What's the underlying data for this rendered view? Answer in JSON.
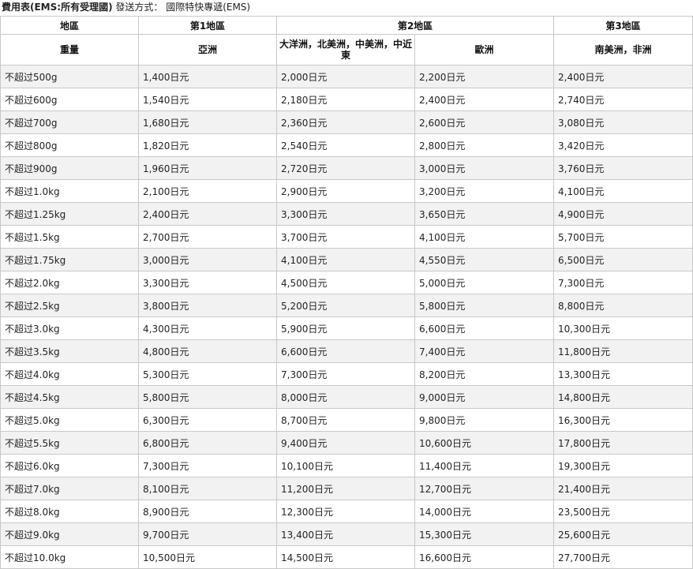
{
  "title": {
    "bold": "費用表(EMS:所有受理國)",
    "rest": " 發送方式： 國際特快專遞(EMS)"
  },
  "header": {
    "row1": [
      "地區",
      "第1地區",
      "第2地區",
      "第3地區"
    ],
    "row2": [
      "重量",
      "亞洲",
      "大洋洲，北美洲，中美洲，中近東",
      "歐洲",
      "南美洲，非洲"
    ]
  },
  "rows": [
    [
      "不超过500g",
      "1,400日元",
      "2,000日元",
      "2,200日元",
      "2,400日元"
    ],
    [
      "不超过600g",
      "1,540日元",
      "2,180日元",
      "2,400日元",
      "2,740日元"
    ],
    [
      "不超过700g",
      "1,680日元",
      "2,360日元",
      "2,600日元",
      "3,080日元"
    ],
    [
      "不超过800g",
      "1,820日元",
      "2,540日元",
      "2,800日元",
      "3,420日元"
    ],
    [
      "不超过900g",
      "1,960日元",
      "2,720日元",
      "3,000日元",
      "3,760日元"
    ],
    [
      "不超过1.0kg",
      "2,100日元",
      "2,900日元",
      "3,200日元",
      "4,100日元"
    ],
    [
      "不超过1.25kg",
      "2,400日元",
      "3,300日元",
      "3,650日元",
      "4,900日元"
    ],
    [
      "不超过1.5kg",
      "2,700日元",
      "3,700日元",
      "4,100日元",
      "5,700日元"
    ],
    [
      "不超过1.75kg",
      "3,000日元",
      "4,100日元",
      "4,550日元",
      "6,500日元"
    ],
    [
      "不超过2.0kg",
      "3,300日元",
      "4,500日元",
      "5,000日元",
      "7,300日元"
    ],
    [
      "不超过2.5kg",
      "3,800日元",
      "5,200日元",
      "5,800日元",
      "8,800日元"
    ],
    [
      "不超过3.0kg",
      "4,300日元",
      "5,900日元",
      "6,600日元",
      "10,300日元"
    ],
    [
      "不超过3.5kg",
      "4,800日元",
      "6,600日元",
      "7,400日元",
      "11,800日元"
    ],
    [
      "不超过4.0kg",
      "5,300日元",
      "7,300日元",
      "8,200日元",
      "13,300日元"
    ],
    [
      "不超过4.5kg",
      "5,800日元",
      "8,000日元",
      "9,000日元",
      "14,800日元"
    ],
    [
      "不超过5.0kg",
      "6,300日元",
      "8,700日元",
      "9,800日元",
      "16,300日元"
    ],
    [
      "不超过5.5kg",
      "6,800日元",
      "9,400日元",
      "10,600日元",
      "17,800日元"
    ],
    [
      "不超过6.0kg",
      "7,300日元",
      "10,100日元",
      "11,400日元",
      "19,300日元"
    ],
    [
      "不超过7.0kg",
      "8,100日元",
      "11,200日元",
      "12,700日元",
      "21,400日元"
    ],
    [
      "不超过8.0kg",
      "8,900日元",
      "12,300日元",
      "14,000日元",
      "23,500日元"
    ],
    [
      "不超过9.0kg",
      "9,700日元",
      "13,400日元",
      "15,300日元",
      "25,600日元"
    ],
    [
      "不超过10.0kg",
      "10,500日元",
      "14,500日元",
      "16,600日元",
      "27,700日元"
    ]
  ]
}
